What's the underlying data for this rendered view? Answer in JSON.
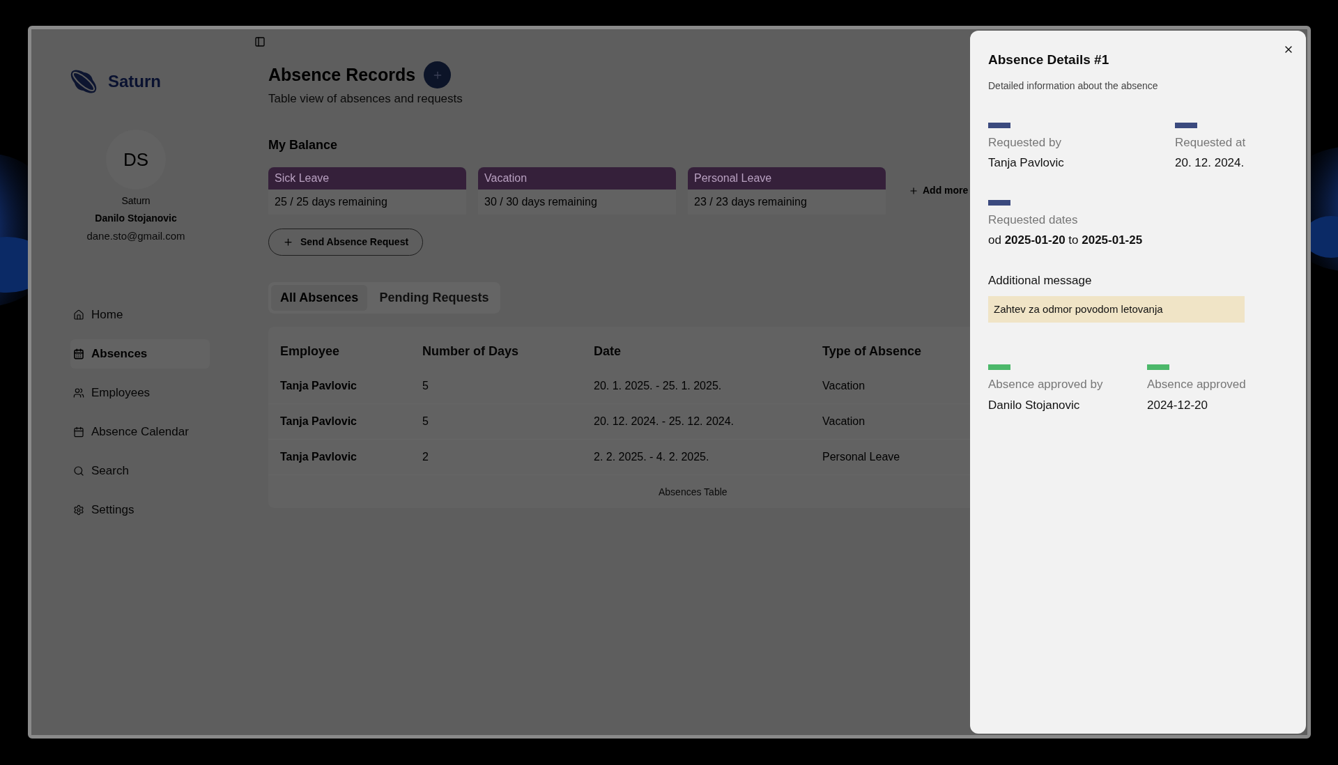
{
  "sidebar": {
    "brand": "Saturn",
    "profile": {
      "initials": "DS",
      "org": "Saturn",
      "name": "Danilo Stojanovic",
      "email": "dane.sto@gmail.com"
    },
    "nav": [
      {
        "label": "Home",
        "selected": false
      },
      {
        "label": "Absences",
        "selected": true
      },
      {
        "label": "Employees",
        "selected": false
      },
      {
        "label": "Absence Calendar",
        "selected": false
      },
      {
        "label": "Search",
        "selected": false
      },
      {
        "label": "Settings",
        "selected": false
      }
    ]
  },
  "page": {
    "title": "Absence Records",
    "subtitle": "Table view of absences and requests",
    "balance_title": "My Balance",
    "balances": [
      {
        "type": "Sick Leave",
        "remaining": "25 / 25 days remaining"
      },
      {
        "type": "Vacation",
        "remaining": "30 / 30 days remaining"
      },
      {
        "type": "Personal Leave",
        "remaining": "23 / 23 days remaining"
      }
    ],
    "add_more": "Add more",
    "send_button": "Send Absence Request",
    "tabs": [
      {
        "label": "All Absences",
        "selected": true
      },
      {
        "label": "Pending Requests",
        "selected": false
      }
    ],
    "table": {
      "columns": [
        "Employee",
        "Number of Days",
        "Date",
        "Type of Absence"
      ],
      "rows": [
        [
          "Tanja Pavlovic",
          "5",
          "20. 1. 2025. - 25. 1. 2025.",
          "Vacation"
        ],
        [
          "Tanja Pavlovic",
          "5",
          "20. 12. 2024. - 25. 12. 2024.",
          "Vacation"
        ],
        [
          "Tanja Pavlovic",
          "2",
          "2. 2. 2025. - 4. 2. 2025.",
          "Personal Leave"
        ]
      ],
      "caption": "Absences Table"
    }
  },
  "drawer": {
    "title": "Absence Details #1",
    "subtitle": "Detailed information about the absence",
    "sections": [
      {
        "fields": [
          {
            "label": "Requested by",
            "value": "Tanja Pavlovic",
            "color": "#3b4a7e"
          },
          {
            "label": "Requested at",
            "value": "20. 12. 2024.",
            "color": "#3b4a7e"
          }
        ]
      },
      {
        "fields": [
          {
            "label": "Requested dates",
            "value": "od **2025-01-20** to **2025-01-25**",
            "color": "#3b4a7e"
          }
        ]
      },
      {
        "message": {
          "label": "Additional message",
          "text": "Zahtev za odmor povodom letovanja"
        }
      },
      {
        "fields": [
          {
            "label": "Absence approved by",
            "value": "Danilo Stojanovic",
            "color": "#4cb86a"
          },
          {
            "label": "Absence approved",
            "value": "2024-12-20",
            "color": "#4cb86a"
          }
        ]
      }
    ]
  }
}
